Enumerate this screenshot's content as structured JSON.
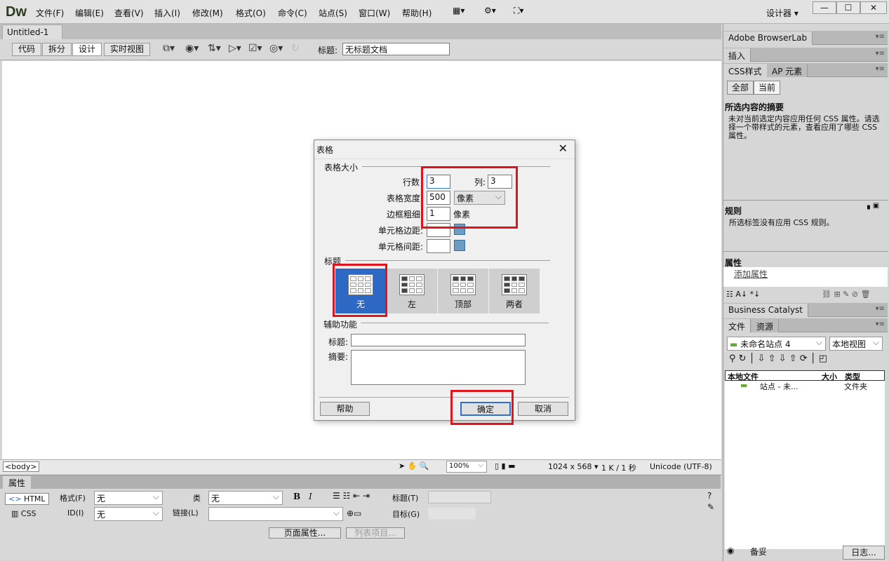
{
  "app": {
    "logo": "Dw",
    "workspace": "设计器 ▾",
    "window_controls": [
      "—",
      "☐",
      "✕"
    ]
  },
  "menu": [
    "文件(F)",
    "编辑(E)",
    "查看(V)",
    "插入(I)",
    "修改(M)",
    "格式(O)",
    "命令(C)",
    "站点(S)",
    "窗口(W)",
    "帮助(H)"
  ],
  "document": {
    "tab": "Untitled-1",
    "close": "×",
    "views": [
      "代码",
      "拆分",
      "设计",
      "实时视图"
    ],
    "active_view": "设计",
    "title_label": "标题:",
    "title_value": "无标题文档"
  },
  "dialog": {
    "title": "表格",
    "close": "✕",
    "size_group": "表格大小",
    "rows_label": "行数",
    "rows": "3",
    "cols_label": "列:",
    "cols": "3",
    "width_label": "表格宽度",
    "width": "500",
    "width_unit": "像素",
    "border_label": "边框粗细",
    "border": "1",
    "border_unit": "像素",
    "padding_label": "单元格边距:",
    "padding": "",
    "spacing_label": "单元格间距:",
    "spacing": "",
    "header_group": "标题",
    "header_options": [
      "无",
      "左",
      "顶部",
      "两者"
    ],
    "header_selected": "无",
    "access_group": "辅助功能",
    "caption_label": "标题:",
    "caption": "",
    "summary_label": "摘要:",
    "summary": "",
    "help": "帮助",
    "ok": "确定",
    "cancel": "取消",
    "highlight_color": "#e0141c"
  },
  "status": {
    "tag": "<body>",
    "zoom": "100%",
    "size": "1024 x 568 ▾",
    "speed": "1 K / 1 秒",
    "encoding": "Unicode (UTF-8)"
  },
  "properties": {
    "title": "属性",
    "html": "HTML",
    "css": "CSS",
    "format_label": "格式(F)",
    "format": "无",
    "class_label": "类",
    "class": "无",
    "id_label": "ID(I)",
    "id": "无",
    "link_label": "链接(L)",
    "link": "",
    "bold": "B",
    "italic": "I",
    "title_label": "标题(T)",
    "target_label": "目标(G)",
    "page_props": "页面属性...",
    "list_item": "列表项目..."
  },
  "panel": {
    "browserlab": "Adobe BrowserLab",
    "insert": "插入",
    "css_tab": "CSS样式",
    "ap_tab": "AP 元素",
    "all": "全部",
    "current": "当前",
    "summary_title": "所选内容的摘要",
    "summary_text": "未对当前选定内容应用任何 CSS 属性。请选择一个带样式的元素，查看应用了哪些 CSS 属性。",
    "rules_title": "规则",
    "rules_text": "所选标签没有应用 CSS 规则。",
    "props_title": "属性",
    "add_prop": "添加属性",
    "bc": "Business Catalyst",
    "files_tab": "文件",
    "assets_tab": "资源",
    "site": "未命名站点 4",
    "view": "本地视图",
    "col_local": "本地文件",
    "col_size": "大小",
    "col_type": "类型",
    "row_name": "站点 - 未...",
    "row_type": "文件夹",
    "ready": "备妥",
    "log": "日志..."
  }
}
